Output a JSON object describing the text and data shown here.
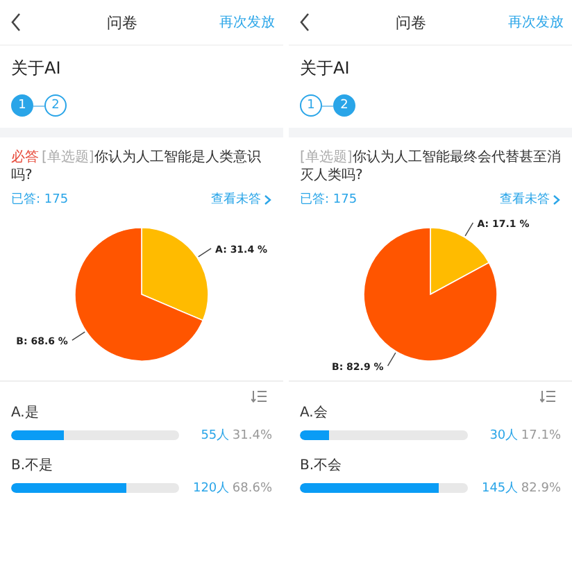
{
  "panels": [
    {
      "header": {
        "title": "问卷",
        "action": "再次发放"
      },
      "survey_title": "关于AI",
      "steps": [
        {
          "label": "1",
          "selected": true
        },
        {
          "label": "2",
          "selected": false
        }
      ],
      "question": {
        "required_tag": "必答",
        "type_tag": "[单选题]",
        "text": "你认为人工智能是人类意识吗?"
      },
      "answered": "已答: 175",
      "view_unanswered": "查看未答",
      "chart_data": {
        "type": "pie",
        "categories": [
          "A",
          "B"
        ],
        "values": [
          31.4,
          68.6
        ],
        "value_labels": [
          "31.4 %",
          "68.6 %"
        ]
      },
      "options": [
        {
          "label": "A.是",
          "level": 0.314,
          "count": "55人",
          "percent": "31.4%"
        },
        {
          "label": "B.不是",
          "level": 0.686,
          "count": "120人",
          "percent": "68.6%"
        }
      ]
    },
    {
      "header": {
        "title": "问卷",
        "action": "再次发放"
      },
      "survey_title": "关于AI",
      "steps": [
        {
          "label": "1",
          "selected": false
        },
        {
          "label": "2",
          "selected": true
        }
      ],
      "question": {
        "type_tag": "[单选题]",
        "text": "你认为人工智能最终会代替甚至消灭人类吗?"
      },
      "answered": "已答: 175",
      "view_unanswered": "查看未答",
      "chart_data": {
        "type": "pie",
        "categories": [
          "A",
          "B"
        ],
        "values": [
          17.1,
          82.9
        ],
        "value_labels": [
          "17.1 %",
          "82.9 %"
        ]
      },
      "options": [
        {
          "label": "A.会",
          "level": 0.171,
          "count": "30人",
          "percent": "17.1%"
        },
        {
          "label": "B.不会",
          "level": 0.829,
          "count": "145人",
          "percent": "82.9%"
        }
      ]
    }
  ]
}
